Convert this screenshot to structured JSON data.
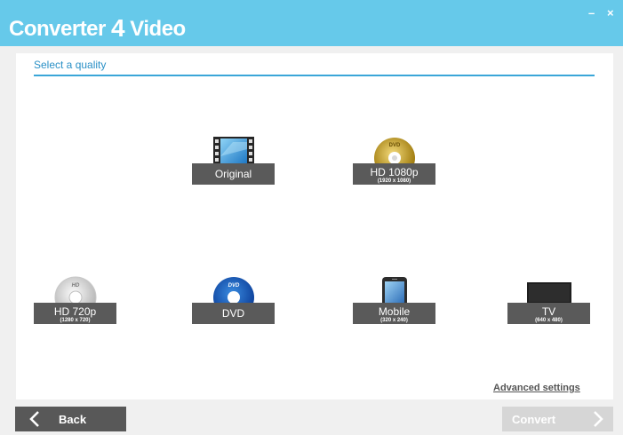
{
  "app": {
    "title_prefix": "Converter ",
    "title_number": "4",
    "title_suffix": " Video",
    "minimize_glyph": "–",
    "close_glyph": "×"
  },
  "section": {
    "title": "Select a quality"
  },
  "qualities": {
    "original": {
      "label": "Original",
      "icon": "film-icon"
    },
    "hd1080": {
      "label": "HD 1080p",
      "resolution": "(1920 x 1080)",
      "icon": "gold-disc-icon"
    },
    "hd720": {
      "label": "HD 720p",
      "resolution": "(1280 x 720)",
      "icon": "silver-disc-icon"
    },
    "dvd": {
      "label": "DVD",
      "icon": "dvd-disc-icon"
    },
    "mobile": {
      "label": "Mobile",
      "resolution": "(320 x 240)",
      "icon": "phone-icon"
    },
    "tv": {
      "label": "TV",
      "resolution": "(640 x 480)",
      "icon": "tv-icon"
    }
  },
  "footer": {
    "advanced_label": "Advanced settings",
    "back_label": "Back",
    "convert_label": "Convert"
  },
  "colors": {
    "titlebar": "#66c9ea",
    "accent": "#2a90c6",
    "caption": "#5a5a5a",
    "back_button": "#585858",
    "convert_disabled": "#d6d6d6"
  }
}
